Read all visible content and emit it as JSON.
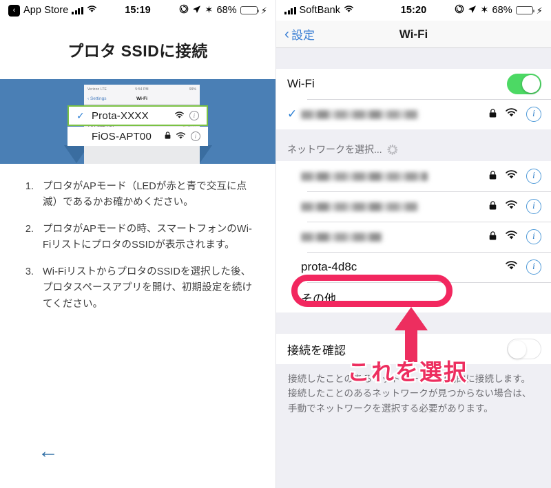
{
  "left": {
    "statusbar": {
      "back_app": "App Store",
      "back_chip": "‹",
      "time": "15:19",
      "battery_pct": "68%",
      "lock_icon": "rotation-lock-icon",
      "location_icon": "location-arrow-icon",
      "bluetooth_icon": "bluetooth-icon",
      "bluetooth_glyph": "✶",
      "charging_glyph": "⚡"
    },
    "title": "プロタ SSIDに接続",
    "hero": {
      "phone_status": {
        "carrier": "Verizon  LTE",
        "time": "5:54 PM",
        "battery": "99%"
      },
      "phone_nav": {
        "back": "‹ Settings",
        "title": "Wi-Fi"
      },
      "callout_selected": {
        "check": "✓",
        "name": "Prota-XXXX"
      },
      "callout_other": {
        "name": "FiOS-APT00"
      },
      "bg_rows": [
        {
          "name": "Prota-XXXX"
        },
        {
          "name": "FiOS-APT00"
        }
      ]
    },
    "steps": [
      {
        "num": "1.",
        "text": "プロタがAPモード（LEDが赤と青で交互に点滅）であるかお確かめください。"
      },
      {
        "num": "2.",
        "text": "プロタがAPモードの時、スマートフォンのWi-FiリストにプロタのSSIDが表示されます。"
      },
      {
        "num": "3.",
        "text": "Wi-FiリストからプロタのSSIDを選択した後、プロタスペースアプリを開け、初期設定を続けてください。"
      }
    ],
    "back_arrow": "←"
  },
  "right": {
    "statusbar": {
      "carrier": "SoftBank",
      "time": "15:20",
      "battery_pct": "68%",
      "bluetooth_glyph": "✶",
      "charging_glyph": "⚡"
    },
    "nav": {
      "back": "設定",
      "back_chevron": "‹",
      "title": "Wi-Fi"
    },
    "wifi_toggle": {
      "label": "Wi-Fi",
      "state": "on"
    },
    "connected_network": {
      "name_hidden": true,
      "checked": true,
      "secured": true
    },
    "section_header": {
      "label": "ネットワークを選択...",
      "spinner": true
    },
    "networks": [
      {
        "name": "",
        "hidden": true,
        "secured": true
      },
      {
        "name": "",
        "hidden": true,
        "secured": true
      },
      {
        "name": "",
        "hidden": true,
        "secured": true
      },
      {
        "name": "prota-4d8c",
        "hidden": false,
        "secured": false,
        "highlighted": true
      },
      {
        "name": "その他...",
        "hidden": false,
        "secured": false
      }
    ],
    "ask_to_join": {
      "label": "接続を確認",
      "state": "off"
    },
    "footnote": "接続したことのあるネットワークに自動的に接続します。接続したことのあるネットワークが見つからない場合は、手動でネットワークを選択する必要があります。"
  },
  "annotation": {
    "text": "これを選択",
    "color": "#ed2e5f",
    "ellipse_color": "#f2275f"
  },
  "colors": {
    "ios_blue": "#3b7fd4",
    "toggle_green": "#4cd964",
    "hero_blue": "#4a7fb5",
    "highlight_green": "#7ac143",
    "annotation_pink": "#ed2e5f",
    "group_bg": "#efeff4"
  }
}
